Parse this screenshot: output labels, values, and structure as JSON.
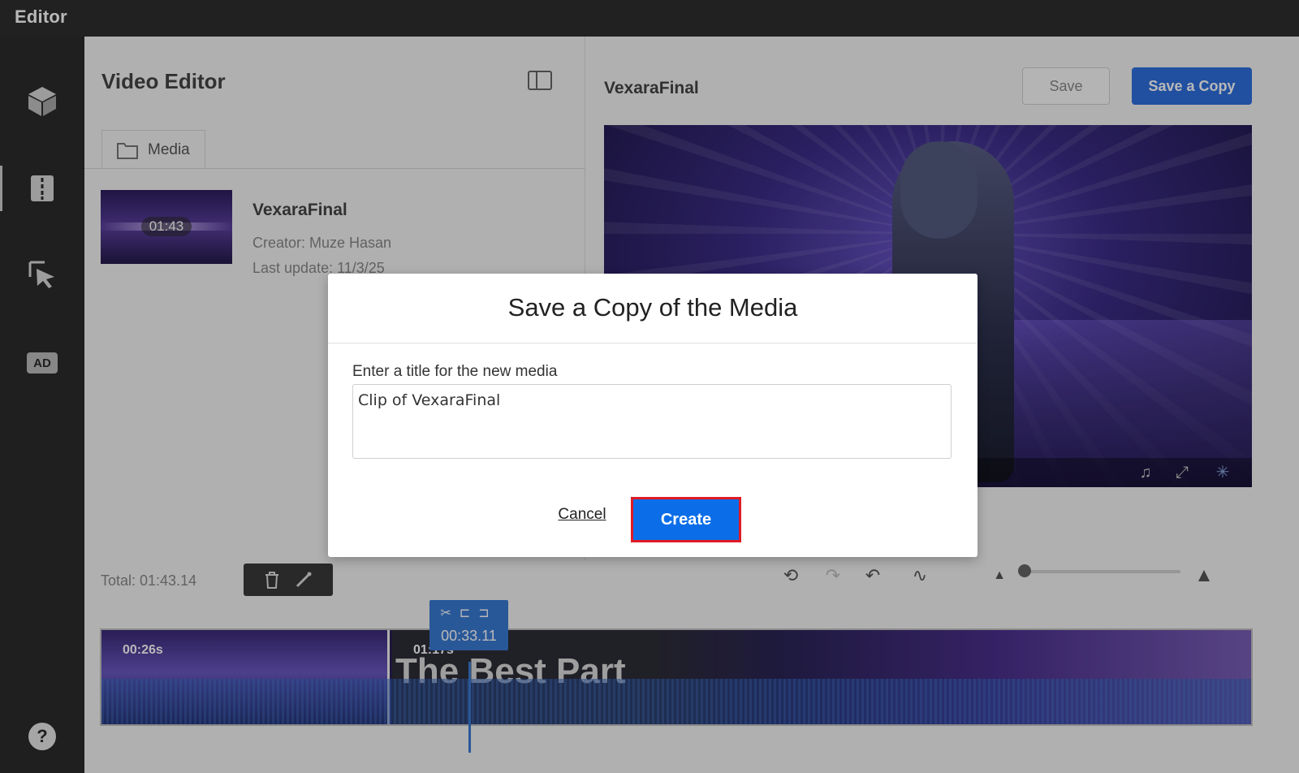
{
  "app": {
    "title": "Editor"
  },
  "nav": {
    "items": [
      {
        "name": "cube-icon"
      },
      {
        "name": "filmstrip-icon"
      },
      {
        "name": "cursor-select-icon"
      },
      {
        "name": "audio-description-icon",
        "badge": "AD"
      },
      {
        "name": "help-icon",
        "glyph": "?"
      }
    ]
  },
  "media_panel": {
    "title": "Video Editor",
    "tab_label": "Media",
    "item": {
      "duration": "01:43",
      "name": "VexaraFinal",
      "creator": "Creator: Muze Hasan",
      "updated": "Last update: 11/3/25"
    }
  },
  "preview": {
    "title": "VexaraFinal",
    "save_label": "Save",
    "save_copy_label": "Save a Copy"
  },
  "timeline": {
    "total": "Total: 01:43.14",
    "clips": [
      {
        "duration": "00:26s"
      },
      {
        "duration": "01:17s",
        "overlay_text": "The Best Part"
      }
    ],
    "playhead_time": "00:33.11",
    "zoom_level": 0.04
  },
  "modal": {
    "title": "Save a Copy of the Media",
    "field_label": "Enter a title for the new media",
    "field_value": "Clip of VexaraFinal",
    "cancel_label": "Cancel",
    "create_label": "Create"
  },
  "colors": {
    "accent": "#2f6fde",
    "create_button": "#0b6ee8",
    "create_outline": "#e01b24",
    "playhead": "#3a7bd5"
  }
}
